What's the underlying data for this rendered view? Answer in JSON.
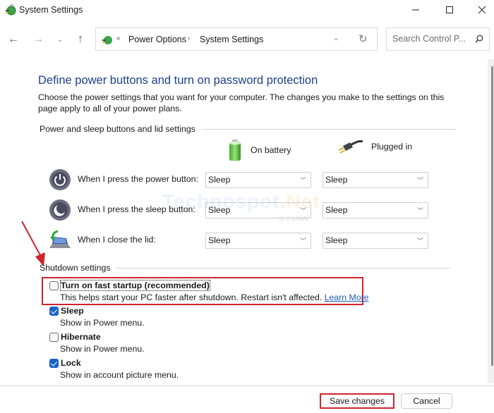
{
  "window": {
    "title": "System Settings",
    "controls": {
      "minimize": "minimize",
      "maximize": "maximize",
      "close": "close"
    }
  },
  "nav": {
    "back_icon": "arrow-left-icon",
    "forward_icon": "arrow-right-icon",
    "recent_icon": "chevron-down-icon",
    "up_icon": "arrow-up-icon",
    "address": {
      "overflow": "«",
      "breadcrumbs": [
        "Power Options",
        "System Settings"
      ],
      "separator": "›"
    },
    "search": {
      "placeholder": "Search Control P...",
      "value": ""
    }
  },
  "page": {
    "title": "Define power buttons and turn on password protection",
    "intro": "Choose the power settings that you want for your computer. The changes you make to the settings on this page apply to all of your power plans.",
    "power_section": {
      "header": "Power and sleep buttons and lid settings",
      "columns": [
        {
          "label": "On battery",
          "icon": "battery-icon"
        },
        {
          "label": "Plugged in",
          "icon": "power-plug-icon"
        }
      ],
      "rows": [
        {
          "label": "When I press the power button:",
          "icon": "power-button-icon",
          "on_battery": "Sleep",
          "plugged_in": "Sleep"
        },
        {
          "label": "When I press the sleep button:",
          "icon": "sleep-button-icon",
          "on_battery": "Sleep",
          "plugged_in": "Sleep"
        },
        {
          "label": "When I close the lid:",
          "icon": "laptop-lid-icon",
          "on_battery": "Sleep",
          "plugged_in": "Sleep"
        }
      ]
    },
    "shutdown_section": {
      "header": "Shutdown settings",
      "options": [
        {
          "label": "Turn on fast startup (recommended)",
          "description": "This helps start your PC faster after shutdown. Restart isn't affected.",
          "link": "Learn More",
          "checked": false
        },
        {
          "label": "Sleep",
          "description": "Show in Power menu.",
          "checked": true
        },
        {
          "label": "Hibernate",
          "description": "Show in Power menu.",
          "checked": false
        },
        {
          "label": "Lock",
          "description": "Show in account picture menu.",
          "checked": true
        }
      ]
    }
  },
  "watermark": {
    "brand": "Technospot",
    "tld": ".Net",
    "handle": "@TSNW"
  },
  "footer": {
    "save_label": "Save changes",
    "cancel_label": "Cancel"
  },
  "colors": {
    "title_blue": "#1e3f8c",
    "annotation_red": "#d0232f",
    "checkbox_blue": "#1b63c6",
    "link_blue": "#1e5cb3"
  }
}
